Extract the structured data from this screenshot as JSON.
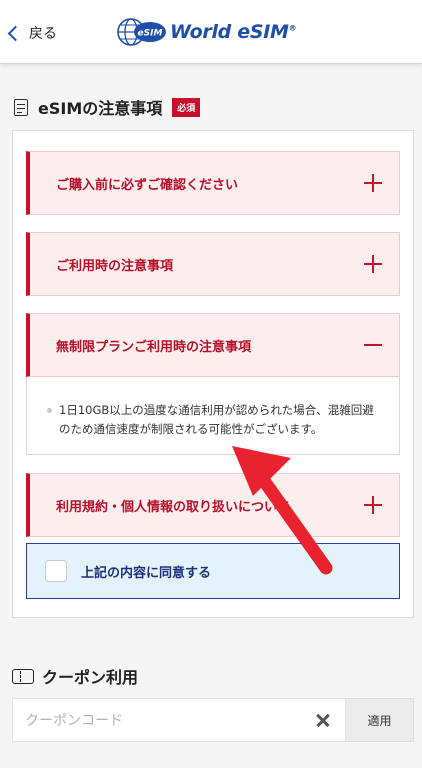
{
  "header": {
    "back_label": "戻る",
    "logo_badge": "eSIM",
    "logo_text": "World eSIM",
    "logo_mark": "®"
  },
  "notice": {
    "title": "eSIMの注意事項",
    "badge": "必須",
    "accordions": [
      {
        "label": "ご購入前に必ずご確認ください",
        "state": "collapsed"
      },
      {
        "label": "ご利用時の注意事項",
        "state": "collapsed"
      },
      {
        "label": "無制限プランご利用時の注意事項",
        "state": "expanded"
      },
      {
        "label": "利用規約・個人情報の取り扱いについて",
        "state": "collapsed"
      }
    ],
    "expanded_body": "1日10GB以上の過度な通信利用が認められた場合、混雑回避のため通信速度が制限される可能性がございます。",
    "agree_label": "上記の内容に同意する"
  },
  "coupon": {
    "title": "クーポン利用",
    "placeholder": "クーポンコード",
    "apply_label": "適用"
  },
  "colors": {
    "accent_red": "#c8102e",
    "brand_blue": "#1f4fa8",
    "agree_bg": "#e4f3fb",
    "arrow_red": "#e8222e"
  }
}
